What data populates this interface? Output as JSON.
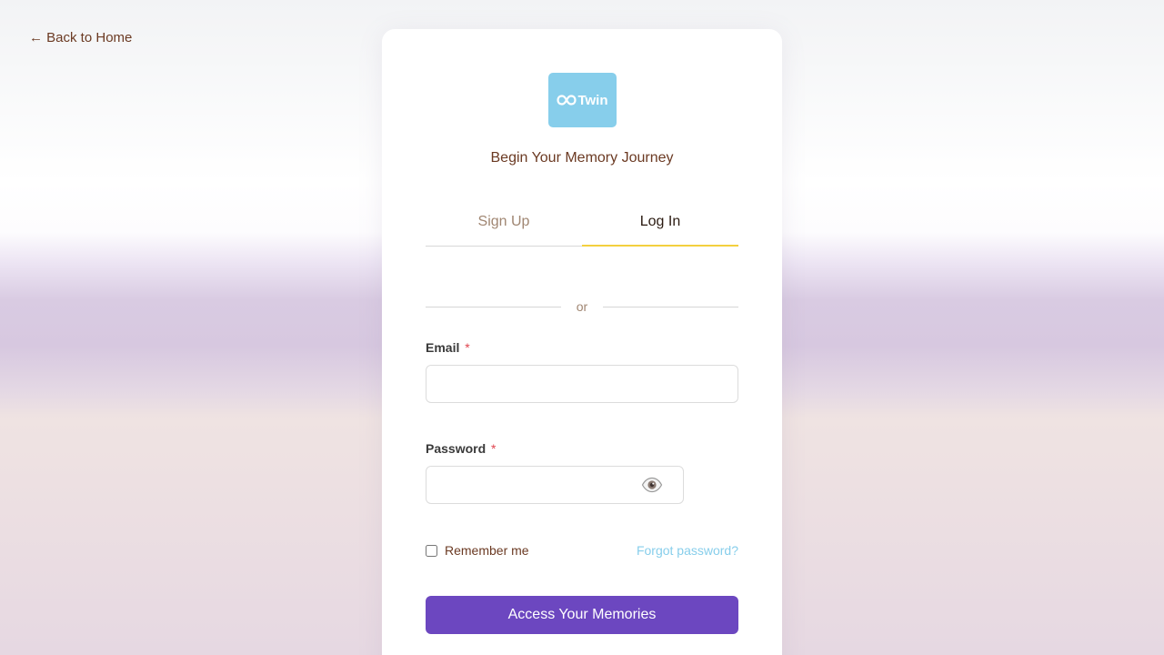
{
  "nav": {
    "back_label": "← Back to Home"
  },
  "brand": {
    "logo_text": "Twin",
    "logo_icon": "infinity-icon",
    "tagline": "Begin Your Memory Journey"
  },
  "tabs": [
    {
      "label": "Sign Up",
      "active": false
    },
    {
      "label": "Log In",
      "active": true
    }
  ],
  "divider_text": "or",
  "form": {
    "email": {
      "label": "Email",
      "required_mark": "*",
      "value": "",
      "placeholder": ""
    },
    "password": {
      "label": "Password",
      "required_mark": "*",
      "value": "",
      "placeholder": "",
      "toggle_icon": "eye-icon"
    },
    "remember_label": "Remember me",
    "remember_checked": false,
    "forgot_label": "Forgot password?",
    "submit_label": "Access Your Memories"
  },
  "colors": {
    "accent": "#6c47c0",
    "logo_bg": "#87ceeb",
    "link": "#87ceeb",
    "tab_underline": "#f3d03e",
    "brown_text": "#6b3a23",
    "required": "#e0454f"
  }
}
